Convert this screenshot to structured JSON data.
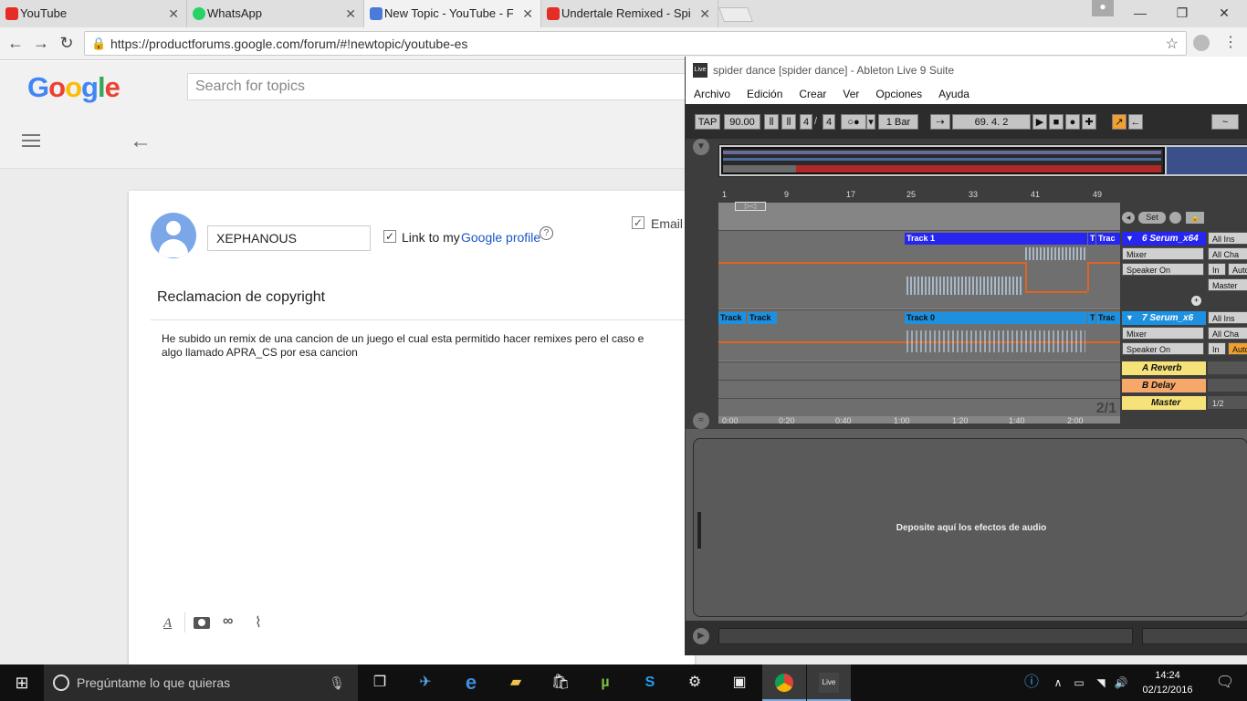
{
  "browser": {
    "tabs": [
      {
        "title": "YouTube",
        "favicon_color": "#e52d27"
      },
      {
        "title": "WhatsApp",
        "favicon_color": "#25d366"
      },
      {
        "title": "New Topic - YouTube - F",
        "favicon_color": "#4a7bd9"
      },
      {
        "title": "Undertale Remixed - Spi",
        "favicon_color": "#e52d27"
      }
    ],
    "url": "https://productforums.google.com/forum/#!newtopic/youtube-es"
  },
  "google": {
    "logo": "Google",
    "search_placeholder": "Search for topics",
    "form": {
      "display_name": "XEPHANOUS",
      "link_label": "Link to my",
      "link_profile": "Google profile",
      "email_label": "Email",
      "subject": "Reclamacion de copyright",
      "body_line1": "He subido un remix de una cancion de un juego el cual esta permitido hacer remixes pero el caso e",
      "body_line2": "algo llamado APRA_CS por esa cancion"
    }
  },
  "ableton": {
    "title": "spider dance  [spider dance] - Ableton Live 9 Suite",
    "app_icon_label": "Live",
    "menu": [
      "Archivo",
      "Edición",
      "Crear",
      "Ver",
      "Opciones",
      "Ayuda"
    ],
    "controls": {
      "tap": "TAP",
      "tempo": "90.00",
      "time_sig_num": "4",
      "time_sig_den": "4",
      "quantize": "1 Bar",
      "position": "69.   4.   2",
      "set_label": "Set"
    },
    "ruler_marks": [
      "1",
      "9",
      "17",
      "25",
      "33",
      "41",
      "49"
    ],
    "time_marks": [
      "0:00",
      "0:20",
      "0:40",
      "1:00",
      "1:20",
      "1:40",
      "2:00"
    ],
    "page_indicator": "2/1",
    "tracks": [
      {
        "name": "6 Serum_x64",
        "mixer": "Mixer",
        "device": "Speaker On",
        "input": "All Ins",
        "channel": "All Cha",
        "monitor_in": "In",
        "monitor_auto": "Auto",
        "output": "Master",
        "clips": [
          "Track 1",
          "T",
          "Trac"
        ]
      },
      {
        "name": "7 Serum_x6",
        "mixer": "Mixer",
        "device": "Speaker On",
        "input": "All Ins",
        "channel": "All Cha",
        "monitor_in": "In",
        "monitor_auto": "Auto",
        "clips": [
          "Track",
          "Track",
          "Track 0",
          "T",
          "Trac"
        ]
      }
    ],
    "returns": [
      {
        "name": "A Reverb"
      },
      {
        "name": "B Delay"
      },
      {
        "name": "Master",
        "meter": "1/2"
      }
    ],
    "device_drop_text": "Deposite aquí los efectos de audio"
  },
  "taskbar": {
    "search_placeholder": "Pregúntame lo que quieras",
    "live_label": "Live",
    "time": "14:24",
    "date": "02/12/2016"
  }
}
